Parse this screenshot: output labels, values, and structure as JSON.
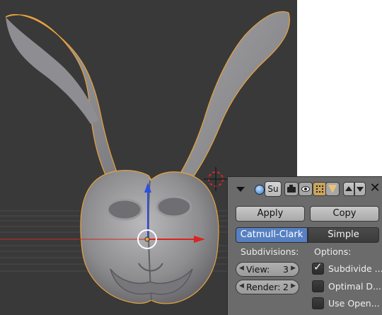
{
  "modifier_panel": {
    "name_field": "Su",
    "apply_label": "Apply",
    "copy_label": "Copy",
    "subdivision_types": [
      "Catmull-Clark",
      "Simple"
    ],
    "active_type": "Catmull-Clark",
    "subdivisions_label": "Subdivisions:",
    "options_label": "Options:",
    "view_label": "View:",
    "view_value": "3",
    "render_label": "Render:",
    "render_value": "2",
    "options": [
      {
        "label": "Subdivide ...",
        "checked": true
      },
      {
        "label": "Optimal D...",
        "checked": false
      },
      {
        "label": "Use Open...",
        "checked": false
      }
    ],
    "icons": [
      "collapse-triangle-icon",
      "modifier-type-icon",
      "camera-render-icon",
      "eye-visibility-icon",
      "editmode-icon",
      "cage-icon",
      "move-up-icon",
      "move-down-icon",
      "close-icon"
    ]
  },
  "colors": {
    "viewport_bg": "#393939",
    "panel_bg": "#6b6b6b",
    "active_blue": "#5680c2",
    "selection_outline": "#e8a33a",
    "x_axis": "#d9241f",
    "z_axis": "#2f4fe0"
  }
}
